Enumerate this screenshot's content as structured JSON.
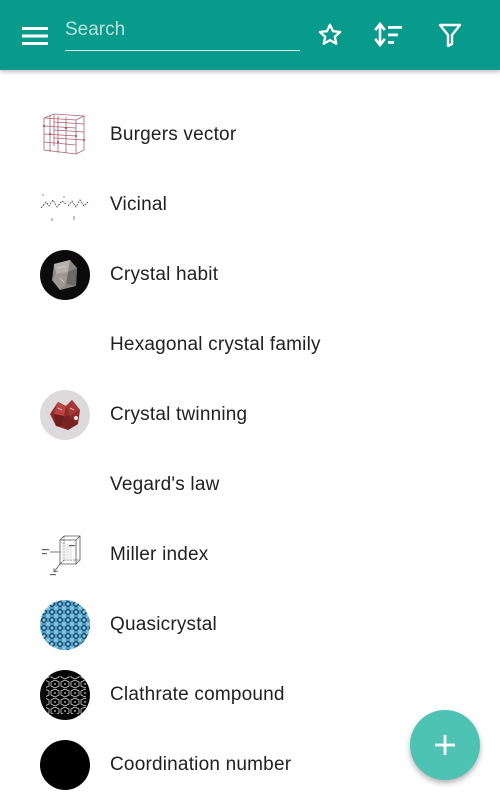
{
  "appbar": {
    "search_placeholder": "Search",
    "icons": [
      "menu-icon",
      "star-icon",
      "sort-icon",
      "filter-icon"
    ]
  },
  "list": {
    "items": [
      {
        "label": "Burgers vector",
        "thumbnail": "lattice-diagram"
      },
      {
        "label": "Vicinal",
        "thumbnail": "step-diagram"
      },
      {
        "label": "Crystal habit",
        "thumbnail": "crystal-photo"
      },
      {
        "label": "Hexagonal crystal family",
        "thumbnail": "none"
      },
      {
        "label": "Crystal twinning",
        "thumbnail": "twinned-crystal-photo"
      },
      {
        "label": "Vegard's law",
        "thumbnail": "none"
      },
      {
        "label": "Miller index",
        "thumbnail": "cube-diagram"
      },
      {
        "label": "Quasicrystal",
        "thumbnail": "blue-pattern"
      },
      {
        "label": "Clathrate compound",
        "thumbnail": "cage-structure"
      },
      {
        "label": "Coordination number",
        "thumbnail": "black-circle"
      }
    ]
  },
  "fab": {
    "icon": "plus-icon"
  },
  "colors": {
    "appbar": "#089a8a",
    "fab": "#4ec3b3",
    "text": "#212121"
  }
}
